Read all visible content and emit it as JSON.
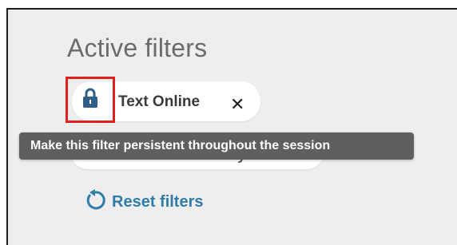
{
  "filters_panel": {
    "title": "Active filters",
    "active_filters": [
      {
        "label": "Text Online",
        "remove_icon": "close-icon"
      },
      {
        "label": "Available in the Library",
        "remove_icon": "close-icon"
      }
    ],
    "lock_icon": "lock-icon",
    "tooltip": "Make this filter persistent throughout the session",
    "reset": {
      "label": "Reset filters",
      "icon": "reset-icon"
    }
  },
  "colors": {
    "panel_bg": "#eeeeee",
    "chip_bg": "#ffffff",
    "lock_icon": "#2f5f86",
    "highlight_box": "#e0201e",
    "tooltip_bg": "#5f5f5f",
    "reset_text": "#2f7da8"
  }
}
